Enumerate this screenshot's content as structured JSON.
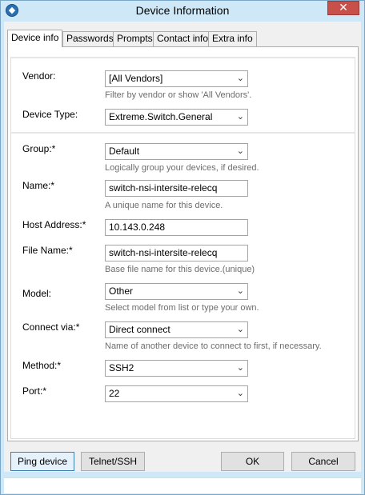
{
  "window": {
    "title": "Device Information",
    "close_glyph": "✕",
    "app_icon_glyph": "◆"
  },
  "tabs": [
    {
      "label": "Device info",
      "active": true
    },
    {
      "label": "Passwords",
      "active": false
    },
    {
      "label": "Prompts",
      "active": false
    },
    {
      "label": "Contact info",
      "active": false
    },
    {
      "label": "Extra info",
      "active": false
    }
  ],
  "form": {
    "vendor": {
      "label": "Vendor:",
      "value": "[All Vendors]",
      "hint": "Filter by vendor or show 'All Vendors'."
    },
    "device_type": {
      "label": "Device Type:",
      "value": "Extreme.Switch.General"
    },
    "group": {
      "label": "Group:*",
      "value": "Default",
      "hint": "Logically group your devices, if desired."
    },
    "name": {
      "label": "Name:*",
      "value": "switch-nsi-intersite-relecq",
      "hint": "A unique name for this device."
    },
    "host_address": {
      "label": "Host Address:*",
      "value": "10.143.0.248"
    },
    "file_name": {
      "label": "File Name:*",
      "value": "switch-nsi-intersite-relecq",
      "hint": "Base file name for this device.(unique)"
    },
    "model": {
      "label": "Model:",
      "value": "Other",
      "hint": "Select model from list or type your own."
    },
    "connect_via": {
      "label": "Connect via:*",
      "value": "Direct connect",
      "hint": "Name of another device to connect to first, if necessary."
    },
    "method": {
      "label": "Method:*",
      "value": "SSH2"
    },
    "port": {
      "label": "Port:*",
      "value": "22"
    }
  },
  "dropdown_arrow": "⌄",
  "buttons": {
    "ping": "Ping device",
    "telnet": "Telnet/SSH",
    "ok": "OK",
    "cancel": "Cancel"
  },
  "colors": {
    "frame": "#cfe8f7",
    "close": "#c7504a",
    "focus_border": "#3c7fb1"
  }
}
